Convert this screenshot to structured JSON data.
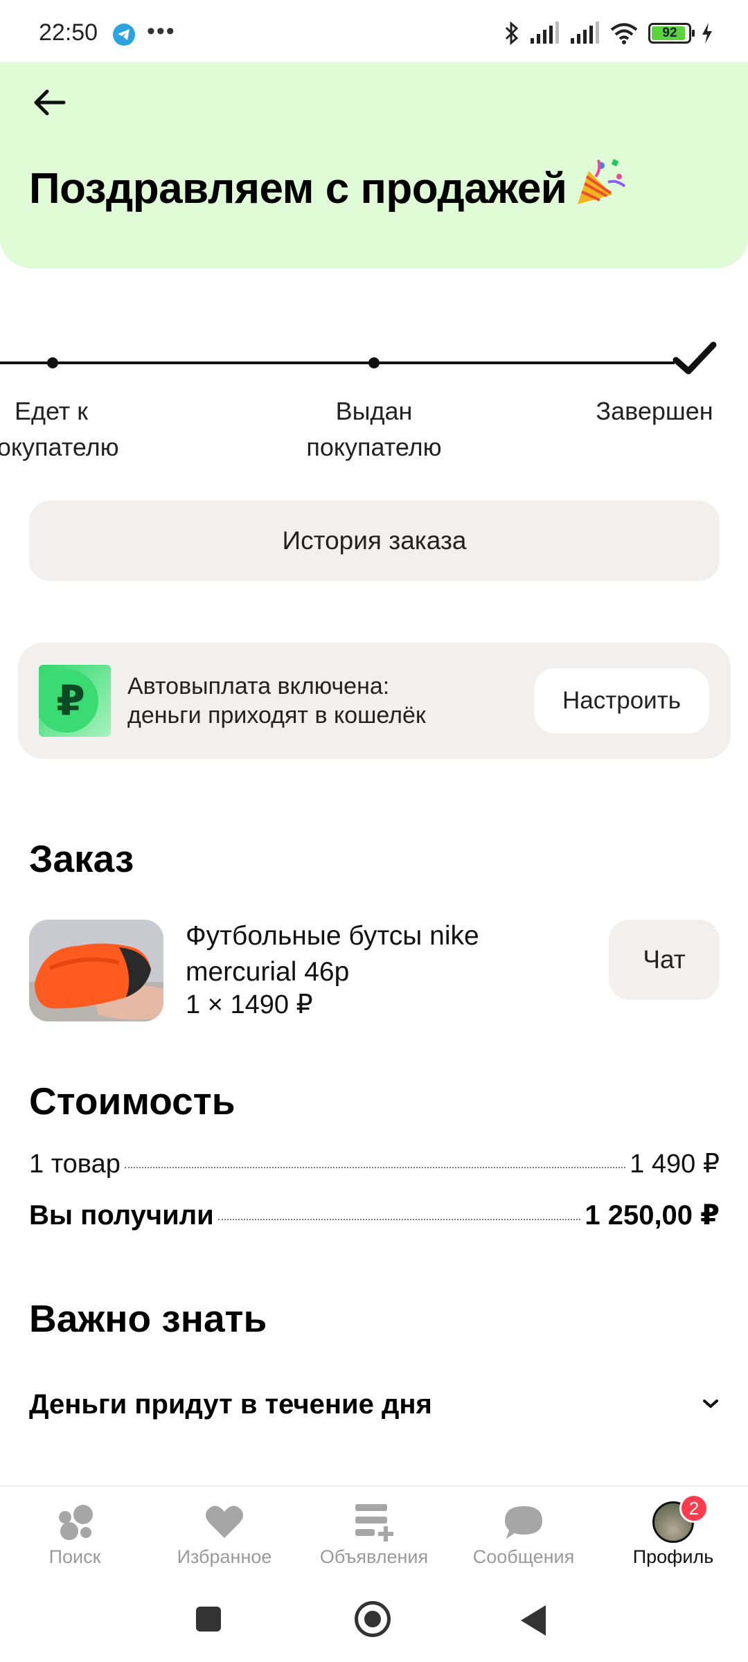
{
  "status_bar": {
    "time": "22:50",
    "more": "•••",
    "battery_level": "92",
    "icons": [
      "telegram-icon",
      "bluetooth-icon",
      "signal-icon",
      "signal-icon",
      "wifi-icon",
      "battery-icon",
      "charging-icon"
    ]
  },
  "header": {
    "title": "Поздравляем с продажей",
    "background_color": "#e0fcd6"
  },
  "progress": {
    "steps": [
      {
        "label": "Едет к\nпокупателю",
        "state": "done"
      },
      {
        "label": "Выдан\nпокупателю",
        "state": "done"
      },
      {
        "label": "Завершен",
        "state": "current"
      }
    ]
  },
  "history_button": {
    "label": "История заказа"
  },
  "autopay": {
    "text": "Автовыплата включена:\nденьги приходят в кошелёк",
    "logo_symbol": "₽",
    "button": "Настроить"
  },
  "order": {
    "title": "Заказ",
    "item_name": "Футбольные бутсы nike mercurial 46р",
    "quantity_price": "1 × 1490 ₽",
    "chat_button": "Чат"
  },
  "cost": {
    "title": "Стоимость",
    "rows": [
      {
        "label": "1 товар",
        "value": "1 490 ₽"
      },
      {
        "label": "Вы получили",
        "value": "1 250,00 ₽"
      }
    ]
  },
  "important": {
    "title": "Важно знать",
    "items": [
      {
        "text": "Деньги придут в течение дня"
      }
    ]
  },
  "bottom_nav": {
    "items": [
      {
        "label": "Поиск",
        "icon": "search-bubbles-icon"
      },
      {
        "label": "Избранное",
        "icon": "heart-icon"
      },
      {
        "label": "Объявления",
        "icon": "listings-icon"
      },
      {
        "label": "Сообщения",
        "icon": "chat-bubble-icon"
      },
      {
        "label": "Профиль",
        "icon": "avatar",
        "badge": "2",
        "active": true
      }
    ]
  }
}
